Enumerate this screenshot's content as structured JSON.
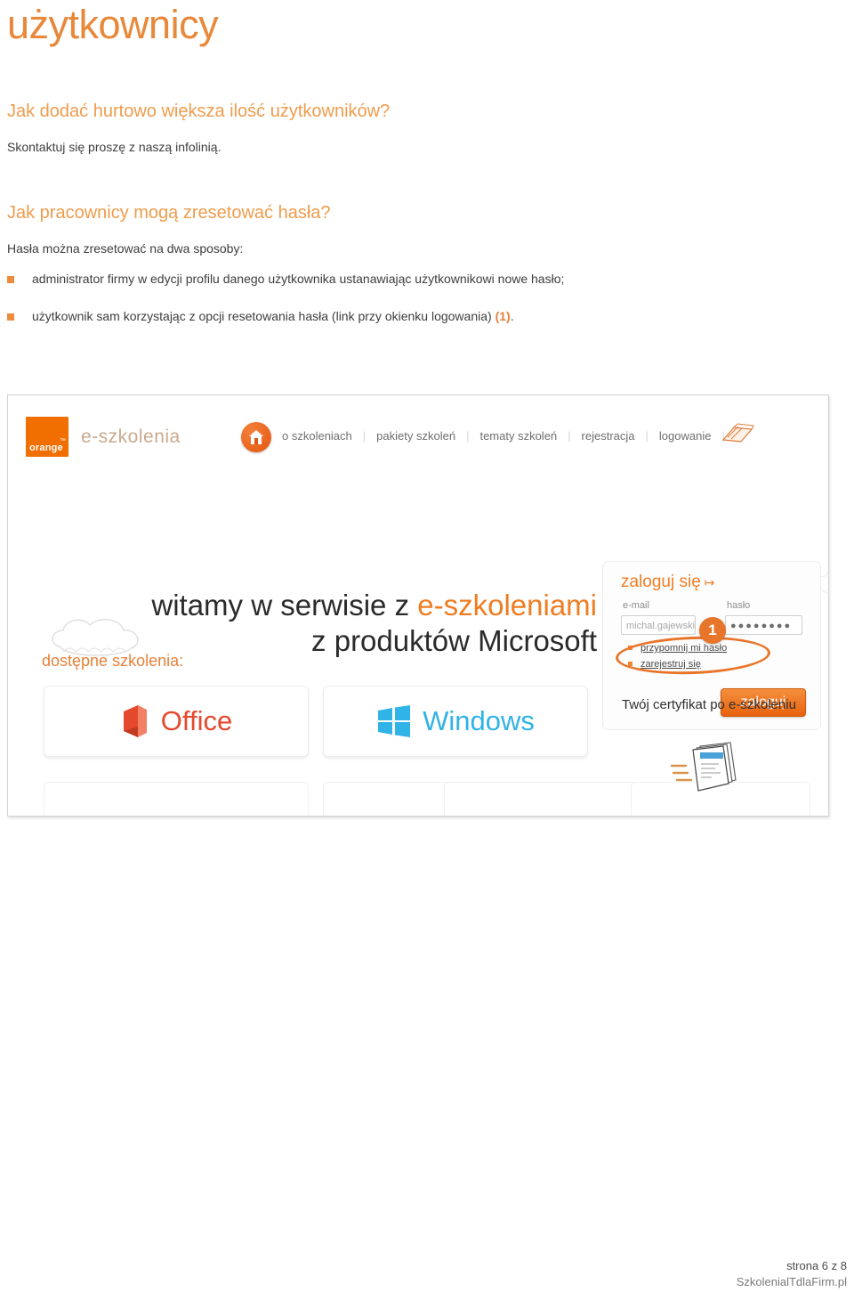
{
  "document": {
    "title": "użytkownicy",
    "q1": "Jak dodać hurtowo większa ilość użytkowników?",
    "a1": "Skontaktuj się proszę z naszą infolinią.",
    "q2": "Jak pracownicy mogą zresetować hasła?",
    "a2": "Hasła można zresetować na dwa sposoby:",
    "bullets": [
      {
        "text": "administrator firmy w edycji profilu danego użytkownika ustanawiając użytkownikowi nowe hasło;"
      },
      {
        "text_before": "użytkownik sam korzystając z opcji resetowania hasła (link przy okienku logowania) ",
        "marker": "(1)",
        "text_after": "."
      }
    ]
  },
  "screenshot": {
    "header": {
      "logo_word": "orange",
      "logo_tm": "™",
      "brand_name": "e-szkolenia",
      "nav": [
        {
          "label": "o szkoleniach"
        },
        {
          "label": "pakiety szkoleń"
        },
        {
          "label": "tematy szkoleń"
        },
        {
          "label": "rejestracja"
        },
        {
          "label": "logowanie"
        }
      ]
    },
    "hero": {
      "line1_plain": "witamy w serwisie z ",
      "line1_accent": "e-szkoleniami",
      "line2": "z produktów Microsoft"
    },
    "login": {
      "title": "zaloguj się",
      "title_arrow": "↦",
      "email_label": "e-mail",
      "password_label": "hasło",
      "email_value": "michal.gajewski",
      "password_value": "●●●●●●●●",
      "forgot_link": "przypomnij mi hasło",
      "register_link": "zarejestruj się",
      "submit_label": "zaloguj",
      "callout_number": "1"
    },
    "courses": {
      "label": "dostępne szkolenia:",
      "tiles": [
        {
          "name": "Office"
        },
        {
          "name": "Windows"
        }
      ]
    },
    "certificate": {
      "title": "Twój certyfikat po e-szkoleniu"
    }
  },
  "footer": {
    "page_label": "strona 6 z 8",
    "brand": "SzkolenialTdlaFirm.pl"
  },
  "colors": {
    "title_orange": "#e8883a",
    "heading_orange": "#ef9c4c",
    "accent_orange": "#ef7d22",
    "orange_logo": "#f16e00",
    "office_red": "#e4492e",
    "windows_blue": "#30b3e6",
    "body_text": "#3d3d3d"
  }
}
